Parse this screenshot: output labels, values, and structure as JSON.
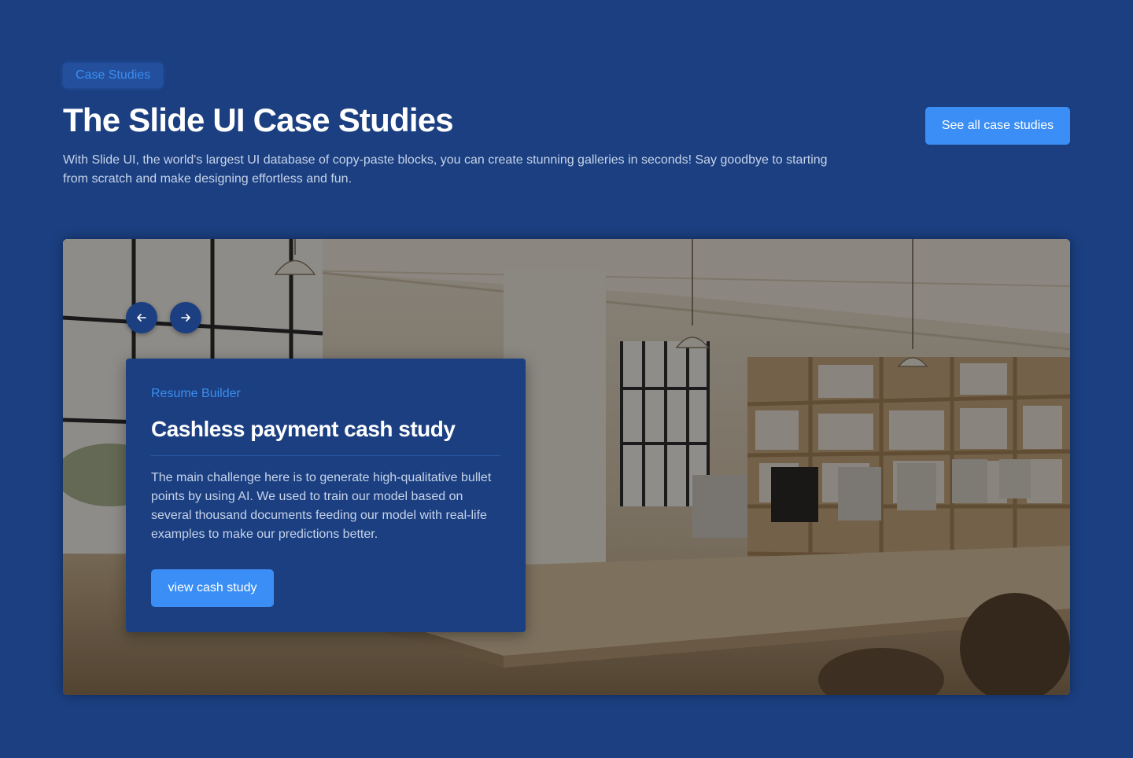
{
  "header": {
    "badge": "Case Studies",
    "title": "The Slide UI Case Studies",
    "description": "With Slide UI, the world's largest UI database of copy-paste blocks, you can create stunning galleries in seconds! Say goodbye to starting from scratch and make designing effortless and fun.",
    "cta_label": "See all case studies"
  },
  "carousel": {
    "prev_icon": "arrow-left-icon",
    "next_icon": "arrow-right-icon",
    "image": "office-interior-photo"
  },
  "card": {
    "category": "Resume Builder",
    "title": "Cashless payment cash study",
    "body": "The main challenge here is to generate high-qualitative bullet points by using AI. We used to train our model based on several thousand documents feeding our model with real-life examples to make our predictions better.",
    "cta_label": "view cash study"
  },
  "colors": {
    "background": "#1b3f80",
    "accent": "#3b8ef5",
    "badge_text": "#3b8ef0"
  }
}
